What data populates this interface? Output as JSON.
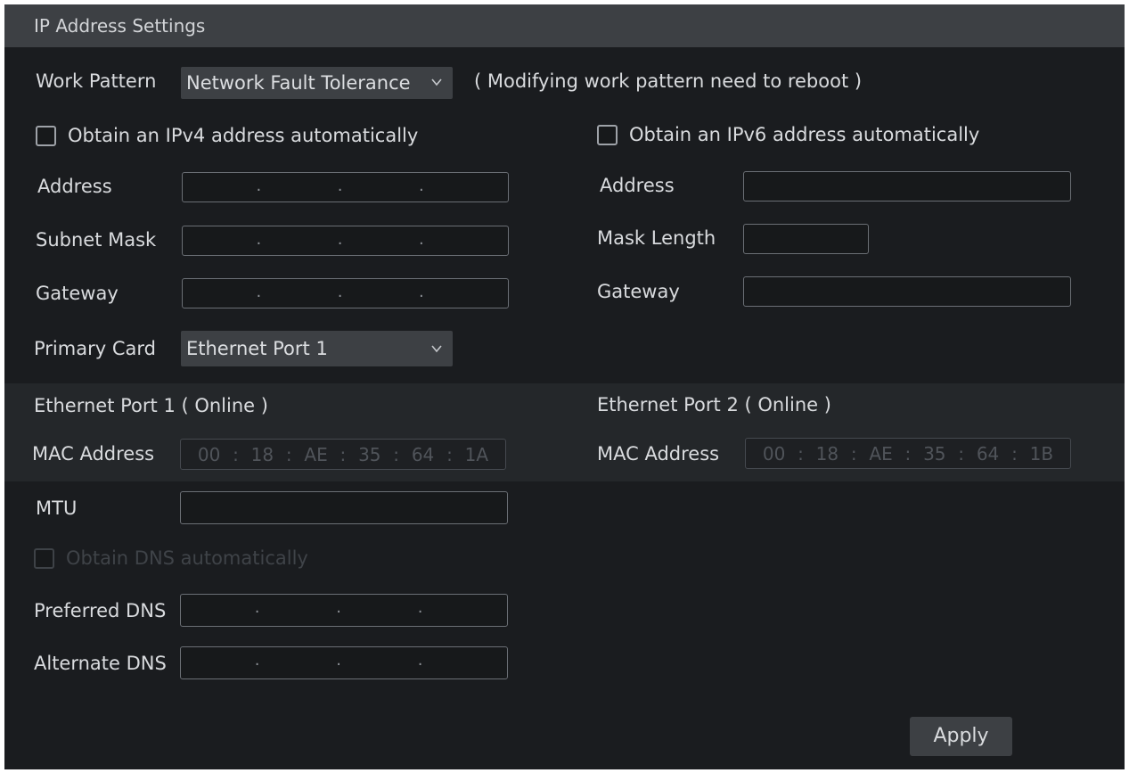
{
  "window": {
    "title": "IP Address Settings"
  },
  "work_pattern": {
    "label": "Work Pattern",
    "value": "Network Fault Tolerance",
    "note": "( Modifying work pattern need to reboot )"
  },
  "ipv4": {
    "auto_label": "Obtain an IPv4 address automatically",
    "address_label": "Address",
    "subnet_label": "Subnet Mask",
    "gateway_label": "Gateway",
    "dot": "."
  },
  "ipv6": {
    "auto_label": "Obtain an IPv6 address automatically",
    "address_label": "Address",
    "mask_length_label": "Mask Length",
    "gateway_label": "Gateway"
  },
  "primary_card": {
    "label": "Primary Card",
    "value": "Ethernet Port 1"
  },
  "eth1": {
    "title": "Ethernet Port 1 ( Online )",
    "mac_label": "MAC Address",
    "mac": [
      "00",
      "18",
      "AE",
      "35",
      "64",
      "1A"
    ]
  },
  "eth2": {
    "title": "Ethernet Port 2 ( Online )",
    "mac_label": "MAC Address",
    "mac": [
      "00",
      "18",
      "AE",
      "35",
      "64",
      "1B"
    ]
  },
  "mac_separator": ":",
  "mtu": {
    "label": "MTU"
  },
  "dns": {
    "auto_label": "Obtain DNS automatically",
    "preferred_label": "Preferred DNS",
    "alternate_label": "Alternate DNS"
  },
  "apply_label": "Apply",
  "colors": {
    "panel": "#1a1c1f",
    "titlebar": "#3d4044",
    "text": "#d9dbde"
  },
  "icons": {
    "dropdown": "chevron-down-icon"
  }
}
